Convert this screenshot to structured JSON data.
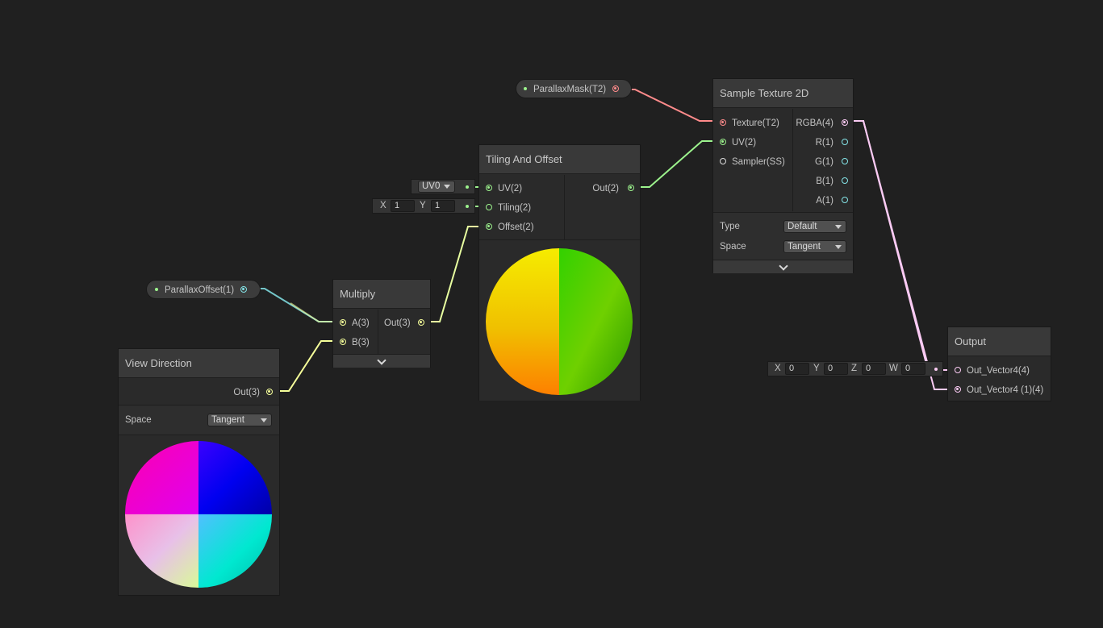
{
  "colors": {
    "background": "#202020",
    "vector2": "#9cf38d",
    "vector3": "#f6ff9a",
    "vector1": "#84e4e7",
    "vector4": "#fbcbf4",
    "texture": "#ff8b8b",
    "sampler": "#dcdcdc"
  },
  "parallax_mask": {
    "label": "ParallaxMask(T2)"
  },
  "parallax_offset": {
    "label": "ParallaxOffset(1)"
  },
  "sample_texture": {
    "title": "Sample Texture 2D",
    "inputs": [
      "Texture(T2)",
      "UV(2)",
      "Sampler(SS)"
    ],
    "outputs": [
      "RGBA(4)",
      "R(1)",
      "G(1)",
      "B(1)",
      "A(1)"
    ],
    "type_label": "Type",
    "type_value": "Default",
    "space_label": "Space",
    "space_value": "Tangent"
  },
  "tiling_offset": {
    "title": "Tiling And Offset",
    "inputs": [
      "UV(2)",
      "Tiling(2)",
      "Offset(2)"
    ],
    "output": "Out(2)",
    "uv_channel": "UV0",
    "tiling_x_label": "X",
    "tiling_x": "1",
    "tiling_y_label": "Y",
    "tiling_y": "1"
  },
  "multiply": {
    "title": "Multiply",
    "inputs": [
      "A(3)",
      "B(3)"
    ],
    "output": "Out(3)"
  },
  "view_direction": {
    "title": "View Direction",
    "output": "Out(3)",
    "space_label": "Space",
    "space_value": "Tangent"
  },
  "output": {
    "title": "Output",
    "inputs": [
      "Out_Vector4(4)",
      "Out_Vector4 (1)(4)"
    ],
    "default_x_label": "X",
    "default_x": "0",
    "default_y_label": "Y",
    "default_y": "0",
    "default_z_label": "Z",
    "default_z": "0",
    "default_w_label": "W",
    "default_w": "0"
  }
}
